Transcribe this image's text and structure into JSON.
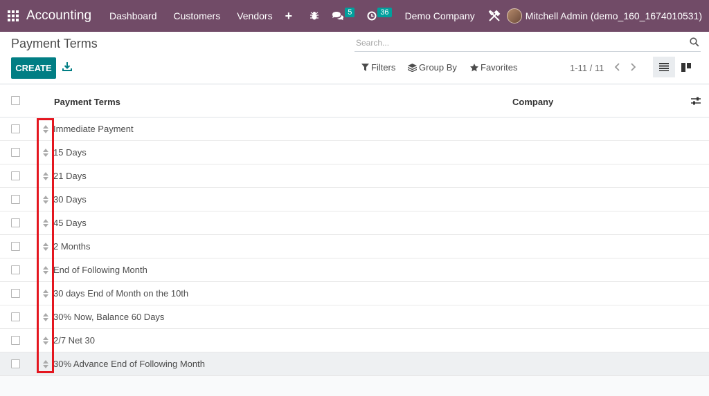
{
  "navbar": {
    "app_name": "Accounting",
    "menu": [
      "Dashboard",
      "Customers",
      "Vendors"
    ],
    "plus": "+",
    "messages_count": "5",
    "activities_count": "36",
    "company": "Demo Company",
    "user": "Mitchell Admin (demo_160_1674010531)",
    "colors": {
      "bar": "#714b67",
      "badge": "#00a09d"
    }
  },
  "control": {
    "title": "Payment Terms",
    "search_placeholder": "Search...",
    "create_label": "CREATE",
    "filters_label": "Filters",
    "groupby_label": "Group By",
    "favorites_label": "Favorites",
    "pager": "1-11 / 11",
    "colors": {
      "create": "#017e84"
    }
  },
  "table": {
    "columns": [
      "Payment Terms",
      "Company"
    ],
    "rows": [
      "Immediate Payment",
      "15 Days",
      "21 Days",
      "30 Days",
      "45 Days",
      "2 Months",
      "End of Following Month",
      "30 days End of Month on the 10th",
      "30% Now, Balance 60 Days",
      "2/7 Net 30",
      "30% Advance End of Following Month"
    ]
  }
}
